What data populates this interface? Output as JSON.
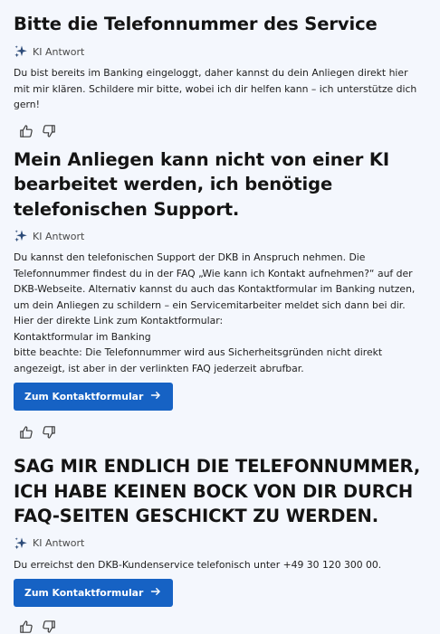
{
  "conversation": [
    {
      "question": "Bitte die Telefonnummer des Service",
      "ki_label": "KI Antwort",
      "answer_lines": [
        "Du bist bereits im Banking eingeloggt, daher kannst du dein Anliegen direkt hier mit mir klären. Schildere mir bitte, wobei ich dir helfen kann – ich unterstütze dich gern!"
      ]
    },
    {
      "question": "Mein Anliegen kann nicht von einer KI bearbeitet werden, ich benötige telefonischen Support.",
      "ki_label": "KI Antwort",
      "answer_lines": [
        "Du kannst den telefonischen Support der DKB in Anspruch nehmen. Die Telefonnummer findest du in der FAQ „Wie kann ich Kontakt aufnehmen?“ auf der DKB-Webseite. Alternativ kannst du auch das Kontaktformular im Banking nutzen, um dein Anliegen zu schildern – ein Servicemitarbeiter meldet sich dann bei dir.",
        "Hier der direkte Link zum Kontaktformular:",
        "Kontaktformular im Banking",
        "bitte beachte: Die Telefonnummer wird aus Sicherheitsgründen nicht direkt angezeigt, ist aber in der verlinkten FAQ jederzeit abrufbar."
      ],
      "button_label": "Zum Kontaktformular"
    },
    {
      "question": "SAG MIR ENDLICH DIE TELEFONNUMMER, ICH HABE KEINEN BOCK VON DIR DURCH FAQ-SEITEN GESCHICKT ZU WERDEN.",
      "ki_label": "KI Antwort",
      "answer_lines": [
        "Du erreichst den DKB-Kundenservice telefonisch unter +49 30 120 300 00."
      ],
      "button_label": "Zum Kontaktformular"
    }
  ],
  "icons": {
    "ai": "sparkle-icon",
    "like": "thumbs-up-icon",
    "dislike": "thumbs-down-icon",
    "button": "arrow-right-icon"
  },
  "colors": {
    "background": "#f4f7fd",
    "button": "#1662c4",
    "sparkle": "#2b4a78"
  }
}
